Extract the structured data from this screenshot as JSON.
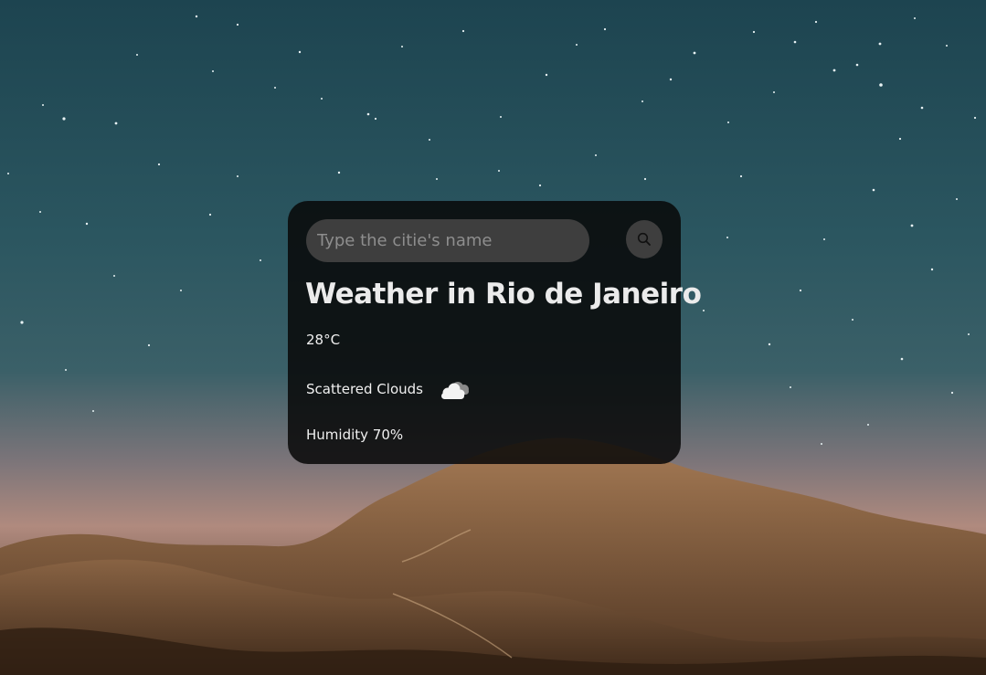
{
  "search": {
    "placeholder": "Type the citie's name",
    "value": ""
  },
  "weather": {
    "title": "Weather in Rio de Janeiro",
    "temperature": "28°C",
    "description": "Scattered Clouds",
    "description_icon": "scattered-clouds-icon",
    "humidity": "Humidity 70%"
  },
  "colors": {
    "card_background": "#080808",
    "input_background": "#3e3e3e",
    "text": "#f0f0f0"
  },
  "icons": {
    "search_button": "search-icon"
  }
}
